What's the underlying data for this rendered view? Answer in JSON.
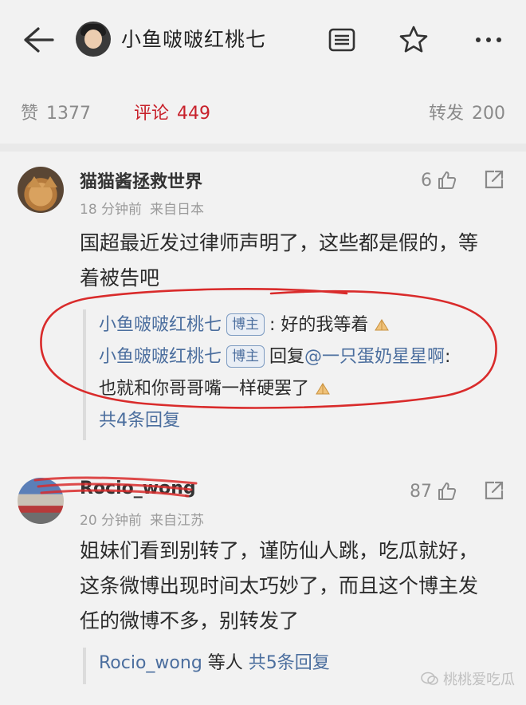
{
  "header": {
    "title": "小鱼啵啵红桃七"
  },
  "stats": {
    "likes_label": "赞",
    "likes_count": "1377",
    "comments_label": "评论",
    "comments_count": "449",
    "reposts_label": "转发",
    "reposts_count": "200"
  },
  "comments": [
    {
      "name": "猫猫酱拯救世界",
      "time": "18 分钟前",
      "source": "来自日本",
      "likes": "6",
      "text_line1": "国超最近发过律师声明了，这些都是假的，等",
      "text_line2": "着被告吧",
      "replies": [
        {
          "name": "小鱼啵啵红桃七",
          "badge": "博主",
          "text": ": 好的我等着"
        },
        {
          "name": "小鱼啵啵红桃七",
          "badge": "博主",
          "reply_word": "回复",
          "mention": "@一只蛋奶星星啊",
          "text": ":",
          "text_line2": "也就和你哥哥嘴一样硬罢了"
        }
      ],
      "more": "共4条回复"
    },
    {
      "name": "Rocio_wong",
      "time": "20 分钟前",
      "source": "来自江苏",
      "likes": "87",
      "text_line1": "姐妹们看到别转了，谨防仙人跳，吃瓜就好，",
      "text_line2": "这条微博出现时间太巧妙了，而且这个博主发",
      "text_line3": "任的微博不多，别转发了",
      "summary_name": "Rocio_wong",
      "summary_mid": " 等人 ",
      "more": "共5条回复"
    }
  ],
  "watermark": "桃桃爱吃瓜",
  "colors": {
    "accent_red": "#c8212b",
    "link_blue": "#4b6e9e",
    "annotation_red": "#d92b2b"
  }
}
